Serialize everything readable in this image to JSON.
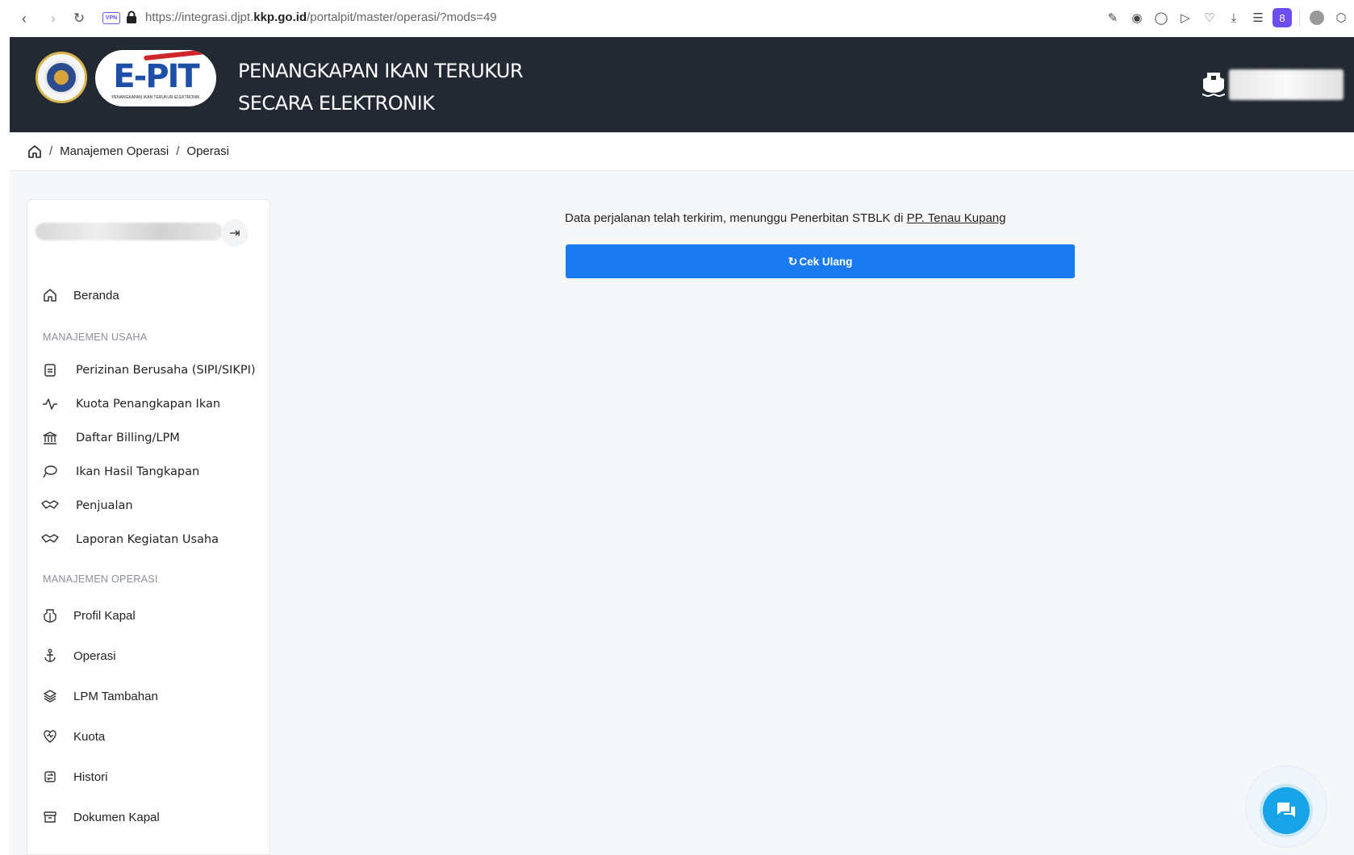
{
  "browser": {
    "url_prefix": "https://integrasi.djpt.",
    "url_domain": "kkp.go.id",
    "url_path": "/portalpit/master/operasi/?mods=49",
    "vpn_badge": "VPN",
    "ext_badge_count": "8"
  },
  "header": {
    "title_line1": "PENANGKAPAN IKAN TERUKUR",
    "title_line2": "SECARA ELEKTRONIK",
    "logo_text": "E-PIT",
    "logo_subtext": "PENANGKAPAN IKAN TERUKUR ELEKTRONIK"
  },
  "breadcrumb": {
    "items": [
      "Manajemen Operasi",
      "Operasi"
    ],
    "separator": "/"
  },
  "sidebar": {
    "home_label": "Beranda",
    "section_usaha": "MANAJEMEN USAHA",
    "usaha_items": [
      {
        "label": "Perizinan Berusaha (SIPI/SIKPI)",
        "icon": "document-icon"
      },
      {
        "label": "Kuota Penangkapan Ikan",
        "icon": "activity-icon"
      },
      {
        "label": "Daftar Billing/LPM",
        "icon": "bank-icon"
      },
      {
        "label": "Ikan Hasil Tangkapan",
        "icon": "fish-icon"
      },
      {
        "label": "Penjualan",
        "icon": "handshake-icon"
      },
      {
        "label": "Laporan Kegiatan Usaha",
        "icon": "handshake-icon"
      }
    ],
    "section_operasi": "MANAJEMEN OPERASI",
    "operasi_items": [
      {
        "label": "Profil Kapal",
        "icon": "ship-icon"
      },
      {
        "label": "Operasi",
        "icon": "anchor-icon"
      },
      {
        "label": "LPM Tambahan",
        "icon": "layers-icon"
      },
      {
        "label": "Kuota",
        "icon": "heart-pulse-icon"
      },
      {
        "label": "Histori",
        "icon": "history-icon"
      },
      {
        "label": "Dokumen Kapal",
        "icon": "archive-icon"
      }
    ]
  },
  "content": {
    "message_prefix": "Data perjalanan telah terkirim, menunggu Penerbitan STBLK di ",
    "message_link": "PP. Tenau Kupang",
    "button_label": "Cek Ulang"
  },
  "colors": {
    "header_bg": "#222933",
    "primary": "#1a7bf0",
    "chat": "#17a3e6"
  }
}
